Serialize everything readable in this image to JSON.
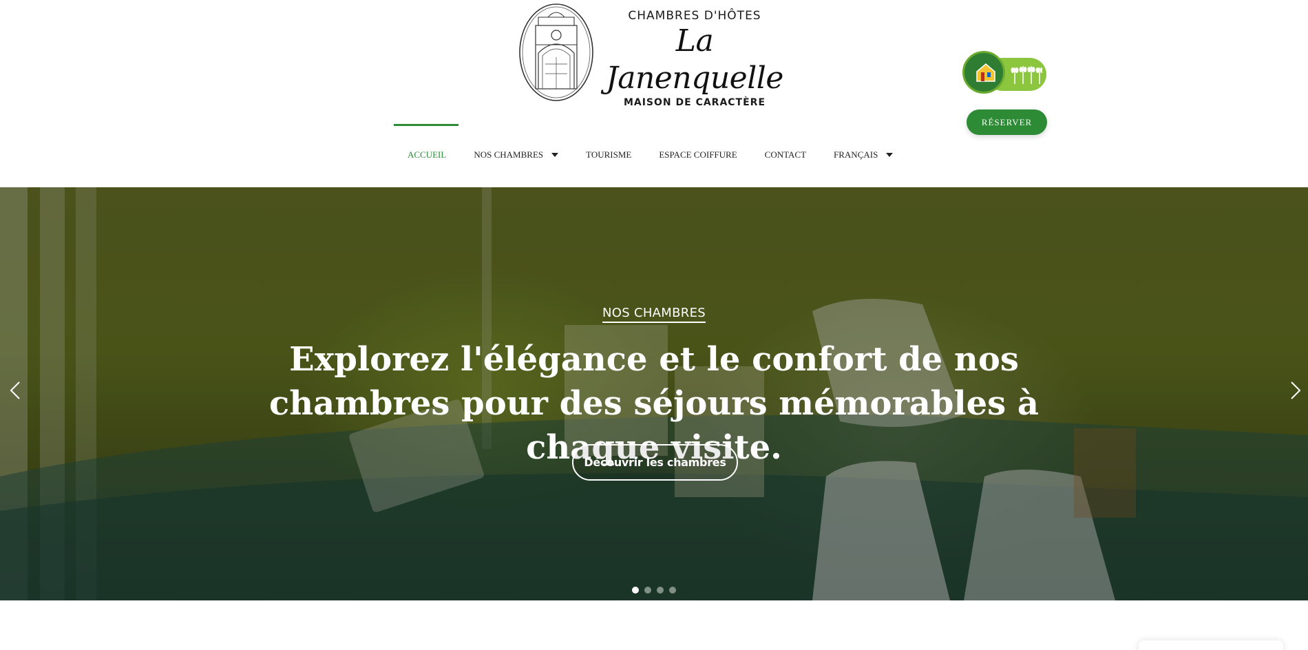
{
  "logo": {
    "top_text": "CHAMBRES D'HÔTES",
    "script_text": "La Janenquelle",
    "bottom_text": "MAISON DE CARACTÈRE",
    "badge_text": "GÎTES DE FRANCE"
  },
  "header": {
    "reserve_label": "RÉSERVER"
  },
  "nav": {
    "items": [
      {
        "label": "ACCUEIL",
        "active": true
      },
      {
        "label": "NOS CHAMBRES",
        "dropdown": true
      },
      {
        "label": "TOURISME"
      },
      {
        "label": "ESPACE COIFFURE"
      },
      {
        "label": "CONTACT"
      },
      {
        "label": "FRANÇAIS",
        "dropdown": true
      }
    ]
  },
  "hero": {
    "subtitle": "NOS CHAMBRES",
    "title": "Explorez l'élégance et le confort de nos chambres pour des séjours mémorables à chaque visite.",
    "button_label": "Découvrir les chambres",
    "slides_total": 4,
    "active_slide": 1
  },
  "colors": {
    "accent": "#2d8a35",
    "badge_green": "#8cc63f"
  },
  "icons": {
    "prev": "chevron-left-icon",
    "next": "chevron-right-icon",
    "dropdown": "caret-down-icon"
  }
}
